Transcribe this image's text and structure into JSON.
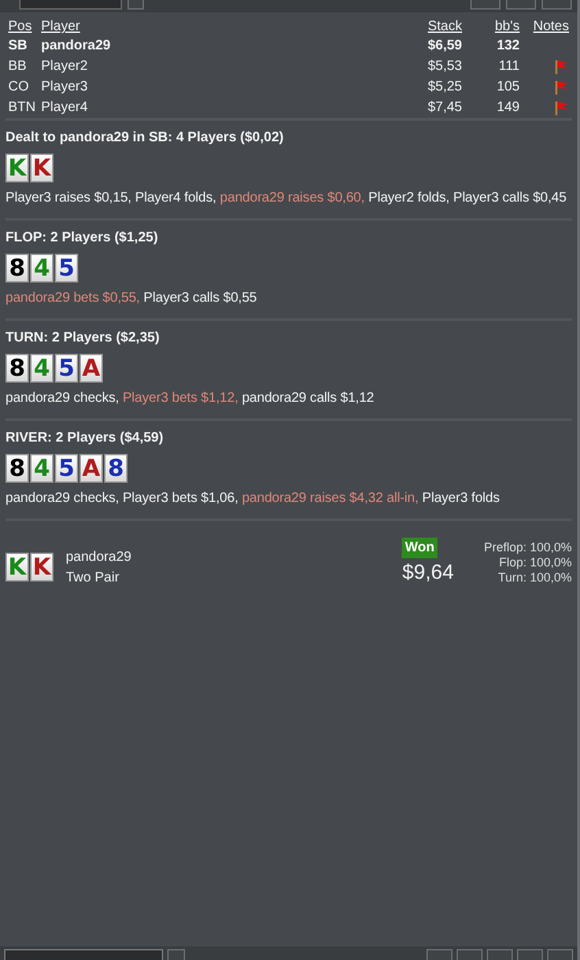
{
  "players_table": {
    "columns": [
      "Pos",
      "Player",
      "Stack",
      "bb's",
      "Notes"
    ],
    "rows": [
      {
        "pos": "SB",
        "player": "pandora29",
        "stack": "$6,59",
        "bbs": "132",
        "hero": true,
        "note": false
      },
      {
        "pos": "BB",
        "player": "Player2",
        "stack": "$5,53",
        "bbs": "111",
        "hero": false,
        "note": true
      },
      {
        "pos": "CO",
        "player": "Player3",
        "stack": "$5,25",
        "bbs": "105",
        "hero": false,
        "note": true
      },
      {
        "pos": "BTN",
        "player": "Player4",
        "stack": "$7,45",
        "bbs": "149",
        "hero": false,
        "note": true
      }
    ]
  },
  "streets": [
    {
      "title": "Dealt to pandora29 in SB: 4 Players ($0,02)",
      "cards": [
        {
          "rank": "K",
          "color": "#1a8a1a"
        },
        {
          "rank": "K",
          "color": "#b01c1c"
        }
      ],
      "actions": [
        {
          "text": "Player3 raises $0,15, Player4 folds, ",
          "hero": false
        },
        {
          "text": "pandora29 raises $0,60,",
          "hero": true
        },
        {
          "text": " Player2 folds, Player3 calls $0,45",
          "hero": false
        }
      ]
    },
    {
      "title": "FLOP: 2 Players ($1,25)",
      "cards": [
        {
          "rank": "8",
          "color": "#000000"
        },
        {
          "rank": "4",
          "color": "#1a8a1a"
        },
        {
          "rank": "5",
          "color": "#1a2fb0"
        }
      ],
      "actions": [
        {
          "text": "pandora29 bets $0,55,",
          "hero": true
        },
        {
          "text": " Player3 calls $0,55",
          "hero": false
        }
      ]
    },
    {
      "title": "TURN: 2 Players ($2,35)",
      "cards": [
        {
          "rank": "8",
          "color": "#000000"
        },
        {
          "rank": "4",
          "color": "#1a8a1a"
        },
        {
          "rank": "5",
          "color": "#1a2fb0"
        },
        {
          "rank": "A",
          "color": "#b01c1c"
        }
      ],
      "actions": [
        {
          "text": "pandora29 checks, ",
          "hero": false
        },
        {
          "text": "Player3 bets $1,12,",
          "hero": true
        },
        {
          "text": " pandora29 calls $1,12",
          "hero": false
        }
      ]
    },
    {
      "title": "RIVER: 2 Players ($4,59)",
      "cards": [
        {
          "rank": "8",
          "color": "#000000"
        },
        {
          "rank": "4",
          "color": "#1a8a1a"
        },
        {
          "rank": "5",
          "color": "#1a2fb0"
        },
        {
          "rank": "A",
          "color": "#b01c1c"
        },
        {
          "rank": "8",
          "color": "#1a2fb0"
        }
      ],
      "actions": [
        {
          "text": "pandora29 checks, Player3 bets $1,06, ",
          "hero": false
        },
        {
          "text": "pandora29 raises $4,32 all-in,",
          "hero": true
        },
        {
          "text": " Player3 folds",
          "hero": false
        }
      ]
    }
  ],
  "result": {
    "cards": [
      {
        "rank": "K",
        "color": "#1a8a1a"
      },
      {
        "rank": "K",
        "color": "#b01c1c"
      }
    ],
    "player": "pandora29",
    "hand": "Two Pair",
    "badge": "Won",
    "amount": "$9,64",
    "equities": [
      {
        "label": "Preflop:",
        "value": "100,0%"
      },
      {
        "label": "Flop:",
        "value": "100,0%"
      },
      {
        "label": "Turn:",
        "value": "100,0%"
      }
    ]
  }
}
